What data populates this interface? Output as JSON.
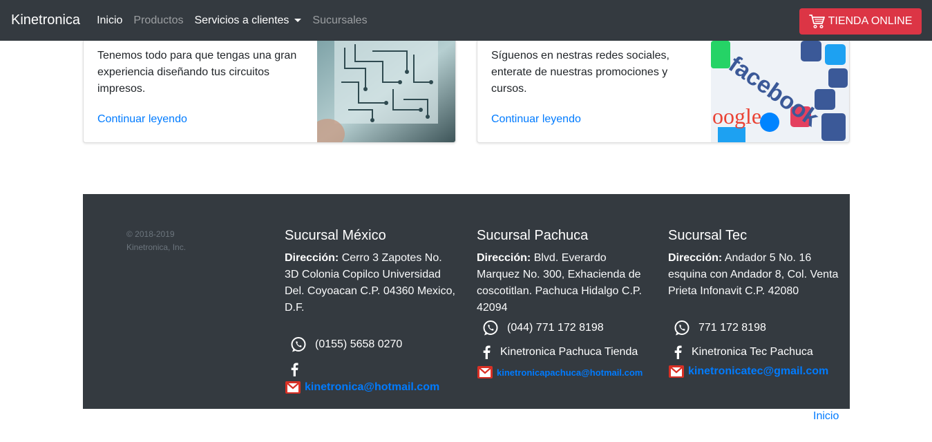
{
  "navbar": {
    "brand": "Kinetronica",
    "links": [
      "Inicio",
      "Productos",
      "Servicios a clientes",
      "Sucursales"
    ],
    "shop_button": "TIENDA ONLINE"
  },
  "cards": [
    {
      "text": "Tenemos todo para que tengas una gran experiencia diseñando tus circuitos impresos.",
      "link": "Continuar leyendo"
    },
    {
      "text": "Síguenos en nestras redes sociales, enterate de nuestras promociones y cursos.",
      "link": "Continuar leyendo"
    }
  ],
  "footer": {
    "copyright_line1": "© 2018-2019",
    "copyright_line2": "Kinetronica, Inc.",
    "address_label": "Dirección:",
    "branches": [
      {
        "title": "Sucursal México",
        "address": "Cerro 3 Zapotes No. 3D Colonia Copilco Universidad Del. Coyoacan C.P. 04360 Mexico, D.F.",
        "phone": "(0155) 5658 0270",
        "facebook": "",
        "email": "kinetronica@hotmail.com"
      },
      {
        "title": "Sucursal Pachuca",
        "address": "Blvd. Everardo Marquez No. 300, Exhacienda de coscotitlan. Pachuca Hidalgo C.P. 42094",
        "phone": "(044) 771 172 8198",
        "facebook": "Kinetronica Pachuca Tienda",
        "email": "kinetronicapachuca@hotmail.com"
      },
      {
        "title": "Sucursal Tec",
        "address": "Andador 5 No. 16 esquina con Andador 8, Col. Venta Prieta Infonavit C.P. 42080",
        "phone": "771 172 8198",
        "facebook": "Kinetronica Tec Pachuca",
        "email": "kinetronicatec@gmail.com"
      }
    ]
  },
  "back_to_top": "Inicio",
  "colors": {
    "navbar_bg": "#343a40",
    "accent_red": "#dc3545",
    "link_blue": "#007bff",
    "footer_bg": "#343a40"
  },
  "icons": [
    "cart-icon",
    "whatsapp-icon",
    "facebook-icon",
    "gmail-icon",
    "chevron-down-icon"
  ]
}
